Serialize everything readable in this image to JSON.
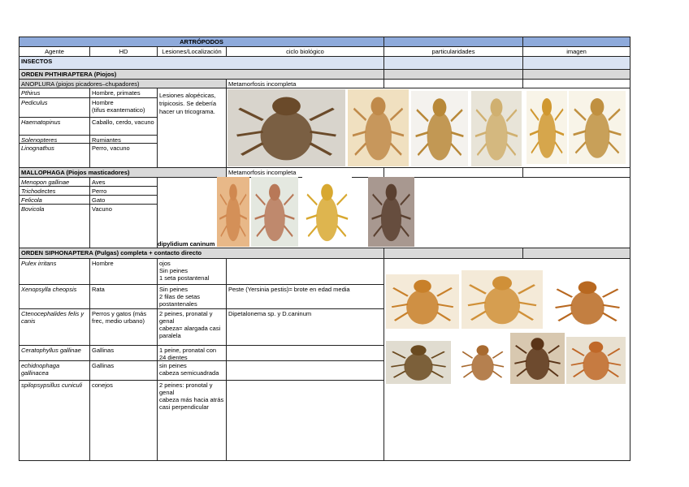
{
  "title": "ARTRÓPODOS",
  "headers": [
    "Agente",
    "HD",
    "Lesiones/Localización",
    "ciclo biológico",
    "particularidades",
    "imagen"
  ],
  "insectos": "INSECTOS",
  "phthiraptera": "ORDEN PHTHIRAPTERA (Piojos)",
  "anoplura": {
    "label": "ANOPLURA (piojos picadores–chupadores)",
    "ciclo": "Metamorfosis incompleta",
    "lesiones": "Lesiones alopécicas, tripicosis. Se debería hacer un tricograma.",
    "rows": [
      {
        "agente": "Pthirus",
        "hd": "Hombre, primates"
      },
      {
        "agente": "Pediculus",
        "hd": "Hombre\n(tifus exantematico)"
      },
      {
        "agente": "Haematopinus",
        "hd": "Caballo, cerdo, vacuno"
      },
      {
        "agente": "Solenopteres",
        "hd": "Rumiantes"
      },
      {
        "agente": "Linognathus",
        "hd": "Perro, vacuno"
      }
    ]
  },
  "mallophaga": {
    "label": "MALLOPHAGA (Piojos masticadores)",
    "ciclo": "Metamorfosis incompleta",
    "note": "dipylidium caninum",
    "rows": [
      {
        "agente": "Menopon gallinae",
        "hd": "Aves"
      },
      {
        "agente": "Trichodectes",
        "hd": "Perro"
      },
      {
        "agente": "Felicola",
        "hd": "Gato"
      },
      {
        "agente": "Bovicola",
        "hd": "Vacuno"
      }
    ]
  },
  "siphonaptera": {
    "label": "ORDEN SIPHONAPTERA (Pulgas) completa + contacto directo",
    "rows": [
      {
        "agente": "Pulex irritans",
        "hd": "Hombre",
        "lesiones": "ojos\nSin peines\n1 seta postantenal",
        "ciclo": ""
      },
      {
        "agente": "Xenopsylla cheopsis",
        "hd": "Rata",
        "lesiones": "Sin peines\n2 filas de setas postantenales",
        "ciclo": "Peste (Yersinia pestis)= brote en edad media"
      },
      {
        "agente": "Ctenocephalides felis y canis",
        "hd": "Perros y gatos (más frec, medio urbano)",
        "lesiones": "2 peines, pronatal y genal\ncabeza= alargada casi paralela",
        "ciclo": "Dipetalonema sp. y D.caninum"
      },
      {
        "agente": "Ceratophyllus gallinae",
        "hd": "Gallinas",
        "lesiones": "1 peine, pronatal con 24 dientes",
        "ciclo": ""
      },
      {
        "agente": "echidnophaga gallinacea",
        "hd": "Gallinas",
        "lesiones": "sin peines\ncabeza semicuadrada",
        "ciclo": ""
      },
      {
        "agente": "spilopsypsillus cuniculi",
        "hd": "conejos",
        "lesiones": "2 peines: pronotal y genal\ncabeza más hacia atrás\ncasi perpendicular",
        "ciclo": ""
      }
    ]
  }
}
